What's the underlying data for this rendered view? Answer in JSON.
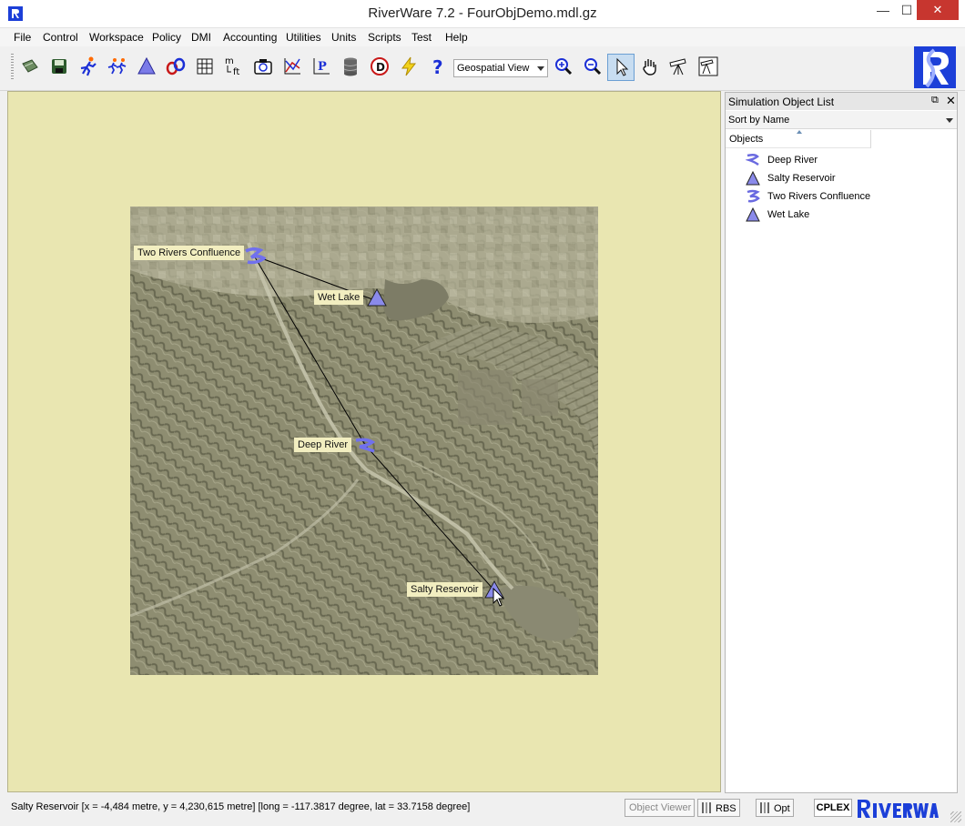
{
  "window": {
    "title": "RiverWare 7.2 - FourObjDemo.mdl.gz",
    "minimize_glyph": "—",
    "maximize_glyph": "☐",
    "close_glyph": "✕"
  },
  "menu": {
    "items": [
      "File",
      "Control",
      "Workspace",
      "Policy",
      "DMI",
      "Accounting",
      "Utilities",
      "Units",
      "Scripts",
      "Test",
      "Help"
    ]
  },
  "toolbar": {
    "buttons": [
      "open-icon",
      "save-icon",
      "run-icon",
      "run-multiple-icon",
      "reservoir-icon",
      "link-icon",
      "grid-icon",
      "units-icon",
      "camera-icon",
      "plot-icon",
      "policy-icon",
      "database-icon",
      "diagnostics-icon",
      "lightning-icon",
      "help-icon",
      "zoom-in-icon",
      "zoom-out-icon",
      "pointer-icon",
      "pan-hand-icon",
      "telescope-icon",
      "view-icon"
    ],
    "units_label_top": "m",
    "units_label_bottom": "ft",
    "policy_letter": "P",
    "diagnostics_letter": "D",
    "help_glyph": "?",
    "view_selector": {
      "selected": "Geospatial View"
    }
  },
  "canvas": {
    "background_color": "#e9e6b1",
    "objects": [
      {
        "name": "Two Rivers Confluence",
        "type": "confluence-icon"
      },
      {
        "name": "Wet Lake",
        "type": "reservoir-icon"
      },
      {
        "name": "Deep River",
        "type": "reach-icon"
      },
      {
        "name": "Salty Reservoir",
        "type": "reservoir-icon"
      }
    ]
  },
  "side_panel": {
    "title": "Simulation Object List",
    "sort_selector": "Sort by Name",
    "column_header": "Objects",
    "items": [
      {
        "label": "Deep River",
        "icon": "reach-icon"
      },
      {
        "label": "Salty Reservoir",
        "icon": "reservoir-icon"
      },
      {
        "label": "Two Rivers Confluence",
        "icon": "confluence-icon"
      },
      {
        "label": "Wet Lake",
        "icon": "reservoir-icon"
      }
    ]
  },
  "status": {
    "text": "Salty Reservoir [x = -4,484 metre, y = 4,230,615 metre] [long = -117.3817 degree, lat = 33.7158 degree]",
    "object_viewer_label": "Object Viewer",
    "rbs_label": "RBS",
    "opt_label": "Opt",
    "cplex_label": "CPLEX"
  },
  "colors": {
    "accent_blue": "#1c3fd8",
    "object_icon": "#8080e0",
    "link_line": "#000000",
    "label_bg": "#f2eec0",
    "close_button": "#c7362f"
  }
}
